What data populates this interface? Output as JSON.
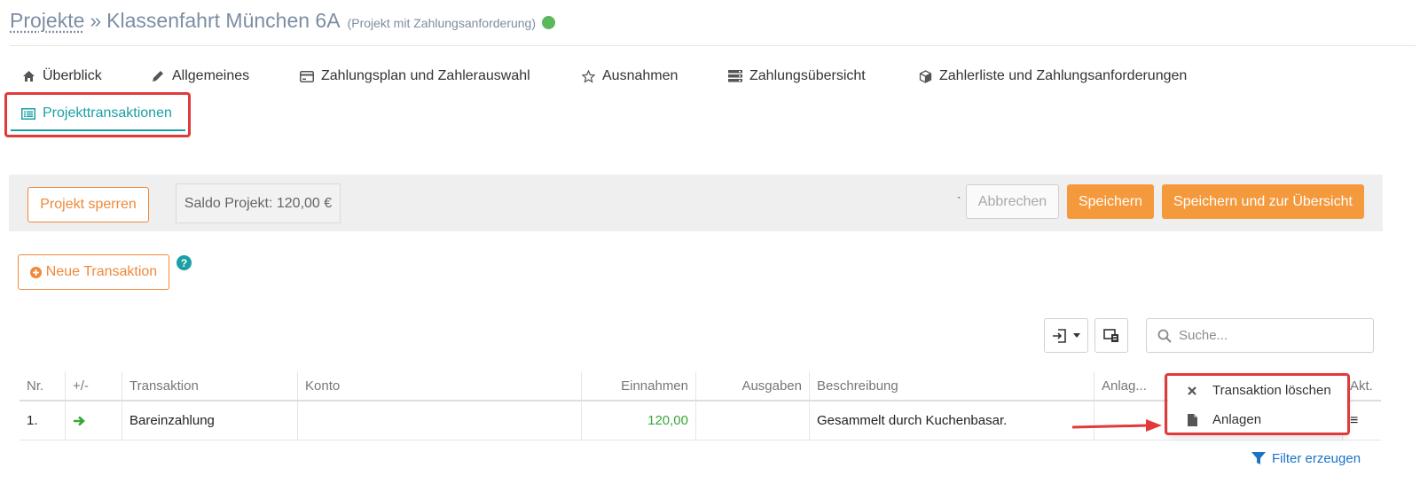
{
  "header": {
    "breadcrumb_link": "Projekte",
    "separator": "»",
    "title": "Klassenfahrt München 6A",
    "subtitle": "(Projekt mit Zahlungsanforderung)",
    "status_color": "#5cb85c"
  },
  "tabs": [
    {
      "label": "Überblick",
      "icon": "home-icon"
    },
    {
      "label": "Allgemeines",
      "icon": "pencil-icon"
    },
    {
      "label": "Zahlungsplan und Zahlerauswahl",
      "icon": "credit-card-icon"
    },
    {
      "label": "Ausnahmen",
      "icon": "star-icon"
    },
    {
      "label": "Zahlungsübersicht",
      "icon": "server-icon"
    },
    {
      "label": "Zahlerliste und Zahlungsanforderungen",
      "icon": "cube-icon"
    },
    {
      "label": "Projekttransaktionen",
      "icon": "list-alt-icon",
      "active": true
    }
  ],
  "toolbar": {
    "lock_label": "Projekt sperren",
    "saldo_label": "Saldo Projekt: 120,00 €",
    "stray_mark": "`",
    "cancel_label": "Abbrechen",
    "save_label": "Speichern",
    "save_overview_label": "Speichern und zur Übersicht"
  },
  "new_transaction_label": "Neue Transaktion",
  "help_label": "?",
  "search": {
    "placeholder": "Suche..."
  },
  "table": {
    "headers": [
      "Nr.",
      "+/-",
      "Transaktion",
      "Konto",
      "Einnahmen",
      "Ausgaben",
      "Beschreibung",
      "Anlag...",
      "Akt."
    ],
    "rows": [
      {
        "nr": "1.",
        "transaction": "Bareinzahlung",
        "account": "",
        "income": "120,00",
        "expense": "",
        "description": "Gesammelt durch Kuchenbasar.",
        "attachments": "",
        "action": "≡"
      }
    ]
  },
  "context_menu": {
    "delete_label": "Transaktion löschen",
    "attachments_label": "Anlagen"
  },
  "filter_label": "Filter erzeugen",
  "colors": {
    "accent": "#1aa0a6",
    "orange": "#f49a3d",
    "highlight": "#e03a3a",
    "income_green": "#3aa53a"
  }
}
